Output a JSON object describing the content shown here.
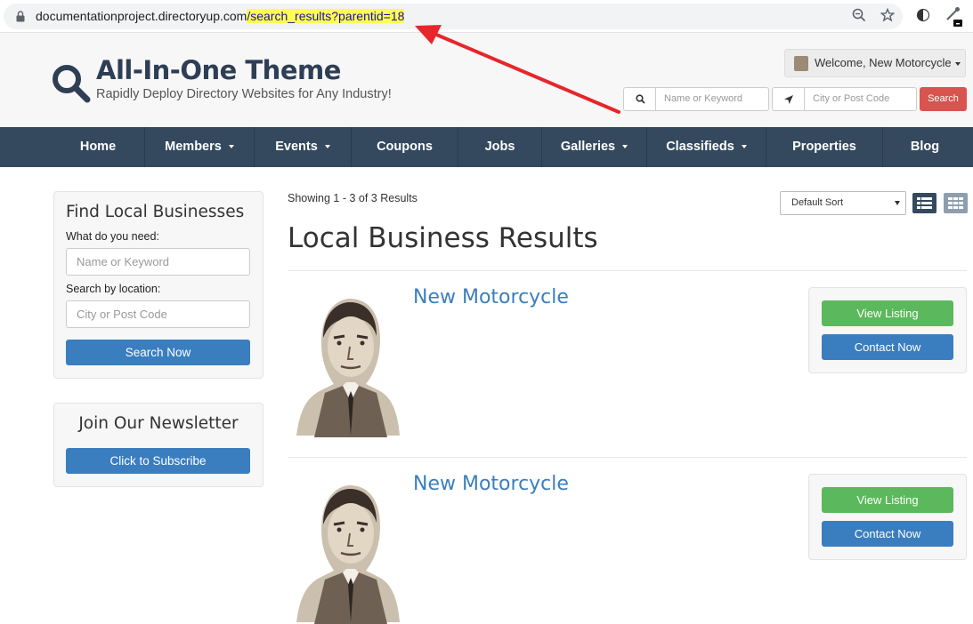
{
  "browser": {
    "url_base": "documentationproject.directoryup.com",
    "url_path": "/search_results?parentid=18"
  },
  "header": {
    "title": "All-In-One Theme",
    "tagline": "Rapidly Deploy Directory Websites for Any Industry!",
    "welcome": "Welcome, New Motorcycle",
    "keyword_placeholder": "Name or Keyword",
    "location_placeholder": "City or Post Code",
    "search_label": "Search"
  },
  "nav": {
    "items": [
      {
        "label": "Home"
      },
      {
        "label": "Members"
      },
      {
        "label": "Events"
      },
      {
        "label": "Coupons"
      },
      {
        "label": "Jobs"
      },
      {
        "label": "Galleries"
      },
      {
        "label": "Classifieds"
      },
      {
        "label": "Properties"
      },
      {
        "label": "Blog"
      }
    ]
  },
  "sidebar": {
    "find_title": "Find Local Businesses",
    "need_label": "What do you need:",
    "need_placeholder": "Name or Keyword",
    "location_label": "Search by location:",
    "location_placeholder": "City or Post Code",
    "search_button": "Search Now",
    "newsletter_title": "Join Our Newsletter",
    "subscribe_button": "Click to Subscribe"
  },
  "main": {
    "showing": "Showing 1 - 3 of 3 Results",
    "sort": "Default Sort",
    "title": "Local Business Results",
    "results": [
      {
        "name": "New Motorcycle",
        "view": "View Listing",
        "contact": "Contact Now"
      },
      {
        "name": "New Motorcycle",
        "view": "View Listing",
        "contact": "Contact Now"
      }
    ]
  },
  "colors": {
    "nav_bg": "#34495e",
    "accent_blue": "#3a7ebf",
    "green": "#5cb85c",
    "red": "#d9534f",
    "highlight": "#ffff52",
    "annotation_arrow": "#e8252b"
  }
}
